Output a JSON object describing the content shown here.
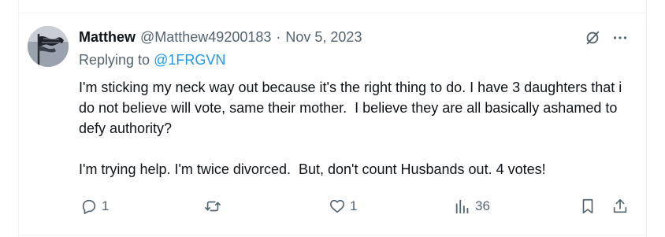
{
  "tweet": {
    "display_name": "Matthew",
    "handle": "@Matthew49200183",
    "separator": "·",
    "timestamp": "Nov 5, 2023",
    "replying_prefix": "Replying to",
    "replying_to": "@1FRGVN",
    "text": "I'm sticking my neck way out because it's the right thing to do. I have 3 daughters that i do not believe will vote, same their mother.  I believe they are all basically ashamed to defy authority?\n\nI'm trying help. I'm twice divorced.  But, don't count Husbands out. 4 votes!"
  },
  "actions": {
    "replies": "1",
    "likes": "1",
    "views": "36"
  },
  "colors": {
    "text": "#0f1419",
    "secondary": "#536471",
    "link": "#1d9bf0",
    "border": "#eff3f4"
  },
  "icons": [
    "avatar-flag",
    "grok-icon",
    "more-icon",
    "reply-icon",
    "retweet-icon",
    "like-icon",
    "views-icon",
    "bookmark-icon",
    "share-icon"
  ]
}
